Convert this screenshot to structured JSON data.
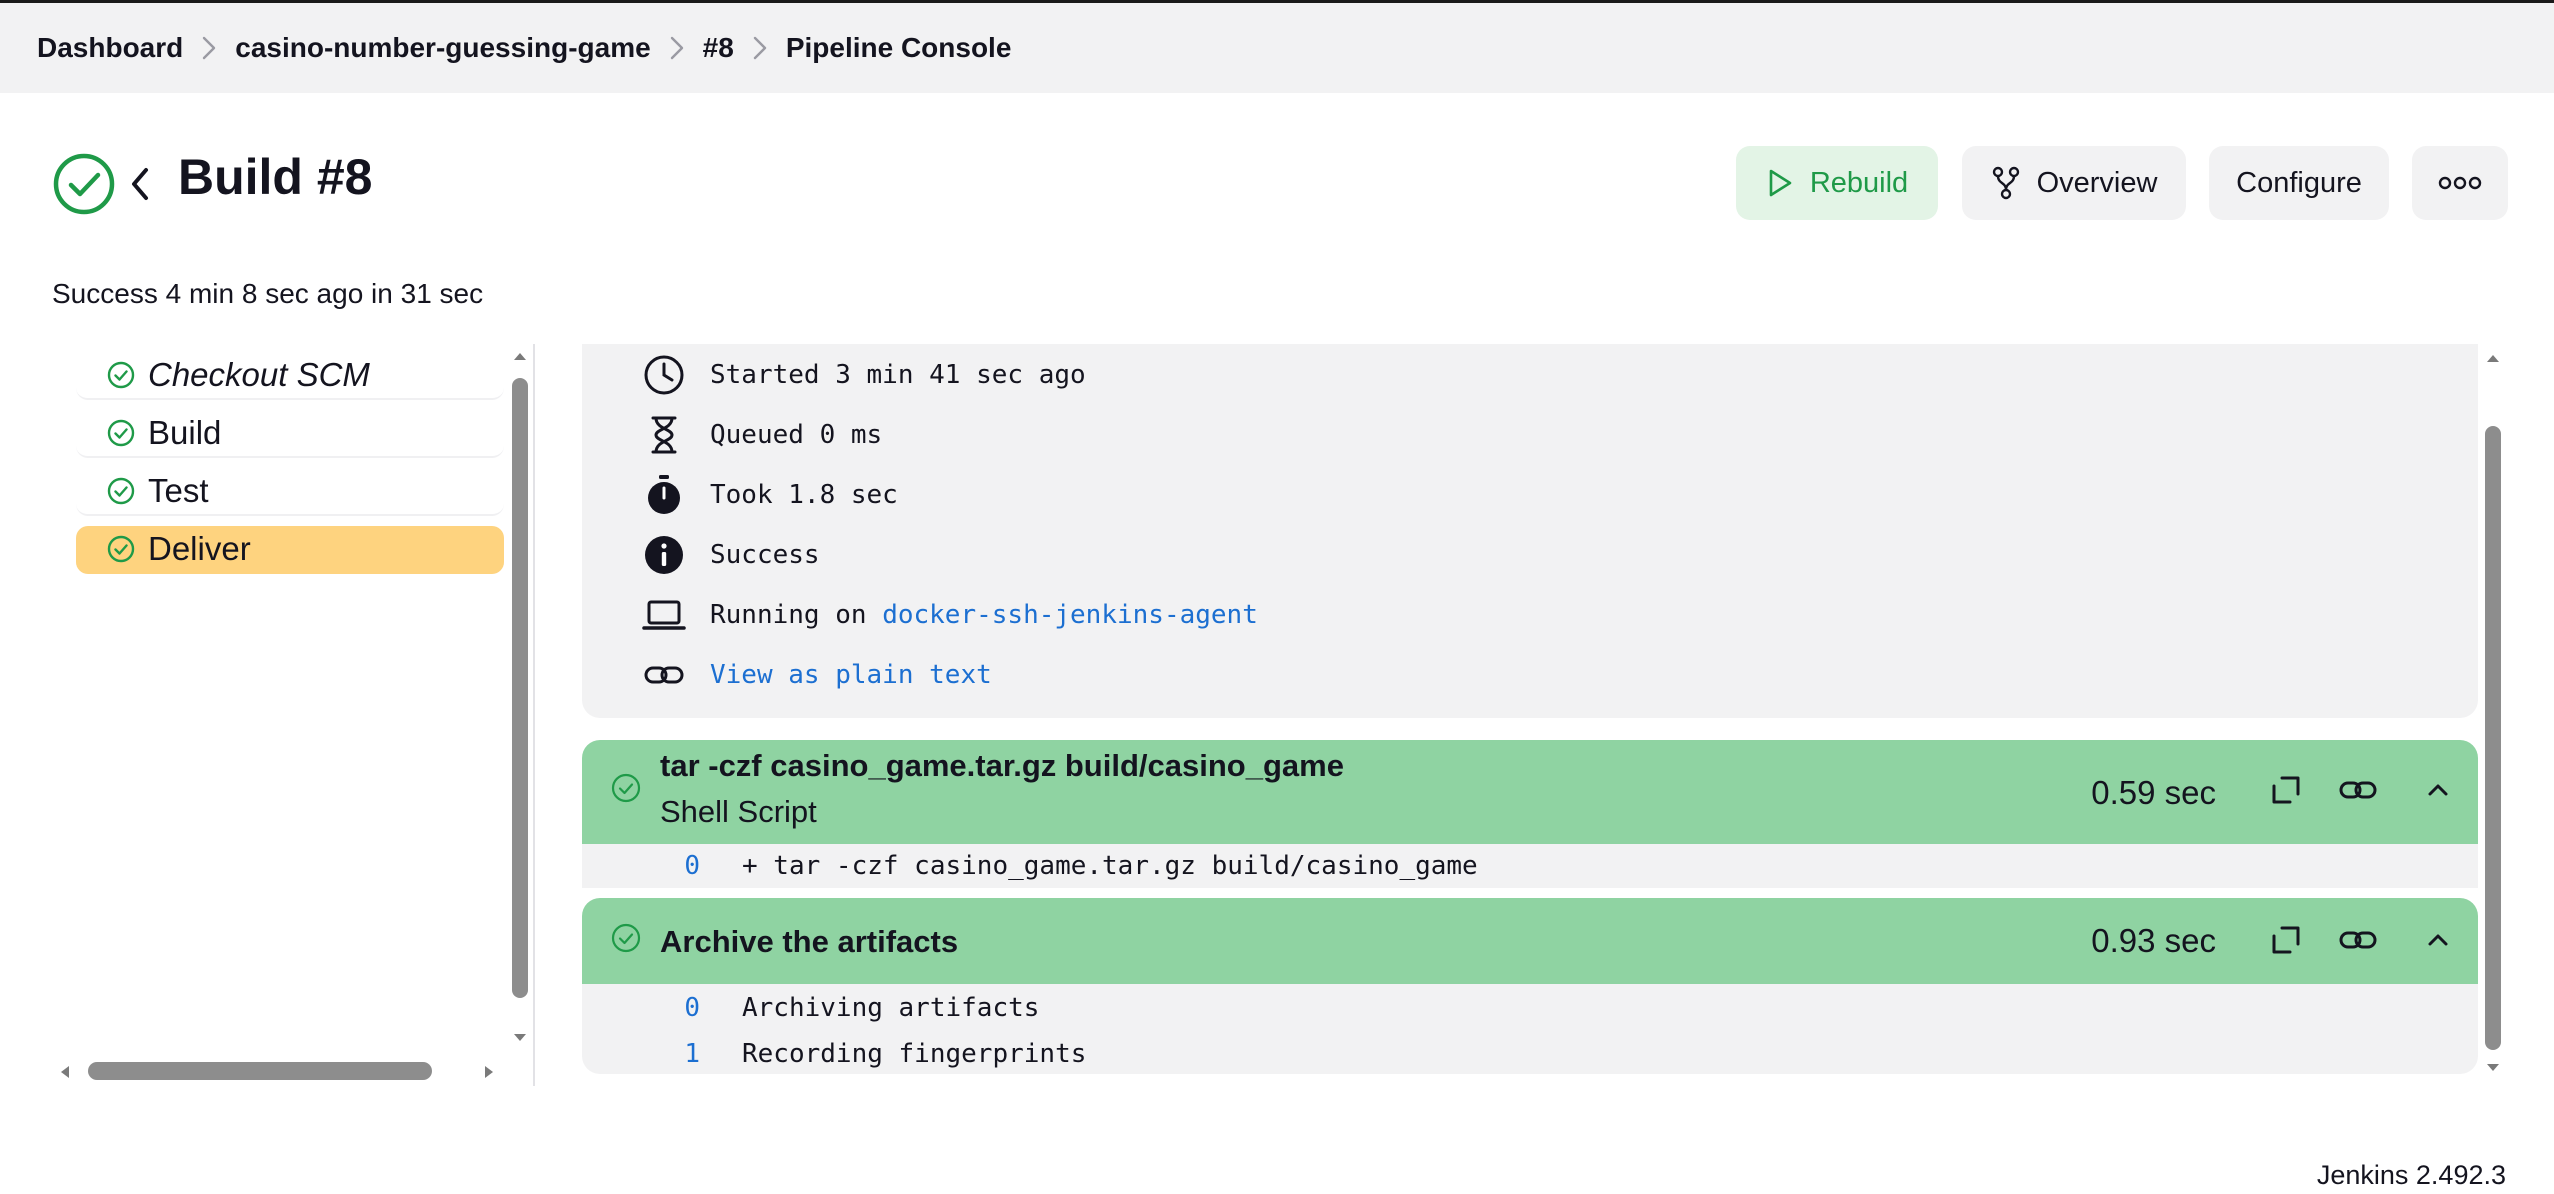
{
  "breadcrumb": {
    "items": [
      "Dashboard",
      "casino-number-guessing-game",
      "#8",
      "Pipeline Console"
    ]
  },
  "header": {
    "title": "Build #8",
    "summary": "Success 4 min 8 sec ago in 31 sec",
    "buttons": {
      "rebuild": "Rebuild",
      "overview": "Overview",
      "configure": "Configure"
    }
  },
  "stages": [
    {
      "label": "Checkout SCM",
      "status": "success"
    },
    {
      "label": "Build",
      "status": "success"
    },
    {
      "label": "Test",
      "status": "success"
    },
    {
      "label": "Deliver",
      "status": "success",
      "selected": true
    }
  ],
  "info": {
    "started": "Started 3 min 41 sec ago",
    "queued": "Queued 0 ms",
    "took": "Took 1.8 sec",
    "status": "Success",
    "running_prefix": "Running on ",
    "agent": "docker-ssh-jenkins-agent",
    "plain_text_link": "View as plain text"
  },
  "steps": [
    {
      "title": "tar -czf casino_game.tar.gz build/casino_game",
      "subtitle": "Shell Script",
      "duration": "0.59 sec",
      "log": [
        {
          "n": "0",
          "text": "+ tar -czf casino_game.tar.gz build/casino_game"
        }
      ]
    },
    {
      "title": "Archive the artifacts",
      "duration": "0.93 sec",
      "log": [
        {
          "n": "0",
          "text": "Archiving artifacts"
        },
        {
          "n": "1",
          "text": "Recording fingerprints"
        }
      ]
    }
  ],
  "footer": {
    "version": "Jenkins 2.492.3"
  },
  "colors": {
    "success": "#1f9a48",
    "step_header": "#8fd3a2",
    "selected_stage": "#fed37f",
    "link": "#1c6fd1"
  }
}
